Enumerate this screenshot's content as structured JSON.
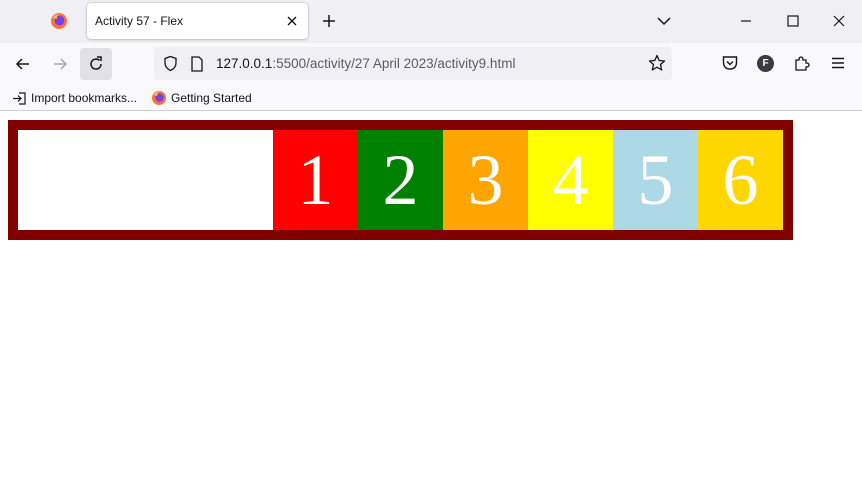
{
  "browser": {
    "tab": {
      "title": "Activity 57 - Flex"
    },
    "url": {
      "host": "127.0.0.1",
      "path": ":5500/activity/27 April 2023/activity9.html"
    },
    "profile_initial": "F",
    "bookmarks": [
      {
        "label": "Import bookmarks...",
        "icon": "import-icon"
      },
      {
        "label": "Getting Started",
        "icon": "firefox-icon"
      }
    ]
  },
  "page": {
    "container_color": "#800000",
    "items": [
      {
        "label": "1",
        "color": "#ff0000"
      },
      {
        "label": "2",
        "color": "#008000"
      },
      {
        "label": "3",
        "color": "#ffa500"
      },
      {
        "label": "4",
        "color": "#ffff00"
      },
      {
        "label": "5",
        "color": "#add8e6"
      },
      {
        "label": "6",
        "color": "#ffd700"
      }
    ]
  }
}
